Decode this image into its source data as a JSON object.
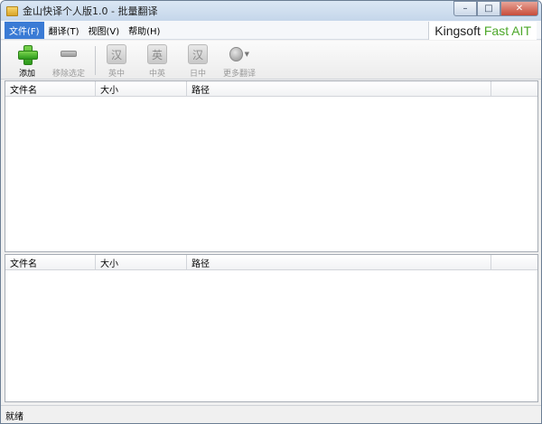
{
  "window": {
    "title": "金山快译个人版1.0 - 批量翻译",
    "controls": {
      "minimize": "–",
      "maximize": "□",
      "close": "✕"
    }
  },
  "menu": {
    "items": [
      {
        "label": "文件(F)",
        "active": true
      },
      {
        "label": "翻译(T)",
        "active": false
      },
      {
        "label": "视图(V)",
        "active": false
      },
      {
        "label": "帮助(H)",
        "active": false
      }
    ]
  },
  "brand": {
    "name": "Kingsoft",
    "product": "Fast AIT",
    "accent_color": "#4ea82b"
  },
  "toolbar": {
    "add": {
      "label": "添加",
      "icon": "plus-icon",
      "enabled": true
    },
    "remove": {
      "label": "移除选定",
      "icon": "minus-icon",
      "enabled": false
    },
    "en_zh": {
      "label": "英中",
      "glyph": "汉",
      "icon": "en-zh-icon",
      "enabled": false
    },
    "zh_en": {
      "label": "中英",
      "glyph": "英",
      "icon": "zh-en-icon",
      "enabled": false
    },
    "ja_zh": {
      "label": "日中",
      "glyph": "汉",
      "icon": "ja-zh-icon",
      "enabled": false
    },
    "more": {
      "label": "更多翻译",
      "icon": "more-translate-icon",
      "caret": "▼",
      "enabled": false
    }
  },
  "top_pane": {
    "columns": [
      "文件名",
      "大小",
      "路径",
      ""
    ],
    "rows": []
  },
  "bottom_pane": {
    "columns": [
      "文件名",
      "大小",
      "路径",
      ""
    ],
    "rows": []
  },
  "status": {
    "text": "就绪"
  }
}
